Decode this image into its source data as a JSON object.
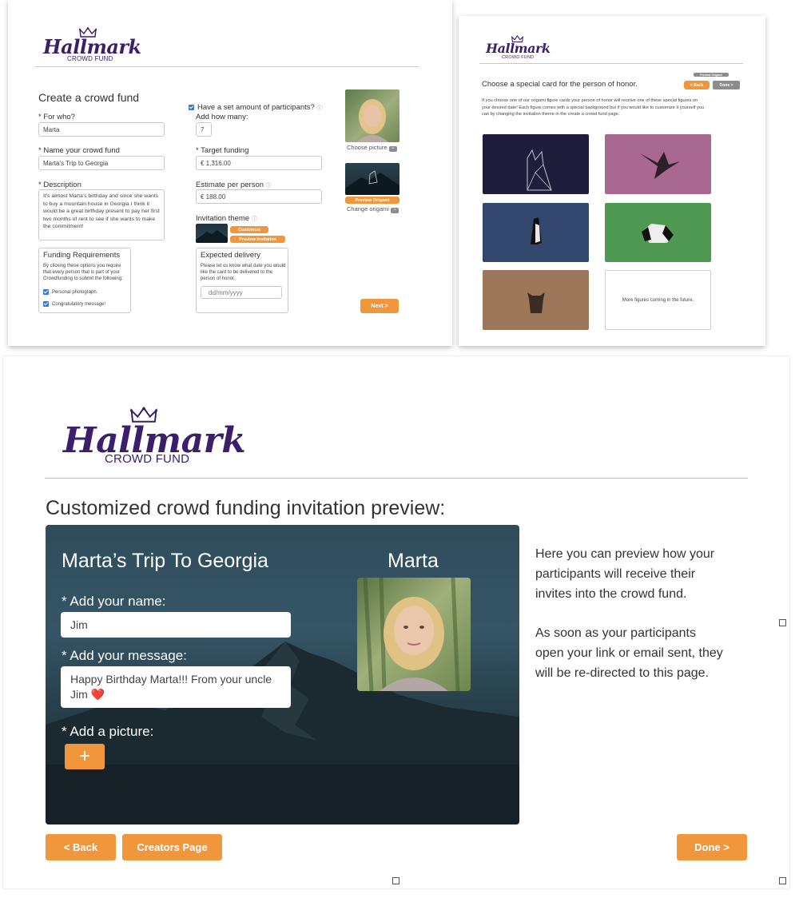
{
  "logo": {
    "script": "Hallmark",
    "sub": "CROWD FUND"
  },
  "p1": {
    "title": "Create a crowd fund",
    "for_who_label": "* For who?",
    "for_who_value": "Marta",
    "name_label": "* Name your crowd fund",
    "name_value": "Marta’s Trip to Georgia",
    "desc_label": "* Description",
    "desc_value": "It’s almost Marta’s birthday and since she wants to buy a mountain house in Georgia I think it would be a great birthday present to pay her first two months of rent to see if she wants to make the commitment!",
    "funding_title": "Funding Requirements",
    "funding_text": "By clicking these options you require that every person that is part of your Crowdfunding to submit the following:",
    "req1": "Personal photograph.",
    "req2": "Congratulatory message!",
    "participants_label": "Have a set amount of participants?",
    "info": "ⓘ",
    "add_how_many": "Add how many:",
    "participants_value": "7",
    "target_label": "* Target funding",
    "target_value": "€ 1,316.00",
    "estimate_label": "Estimate per person",
    "estimate_value": "€ 188.00",
    "theme_label": "Invitation theme",
    "customize": "Customize",
    "preview_invitation": "Preview Invitation",
    "delivery_title": "Expected delivery",
    "delivery_text": "Please let us know what date you would like the card to be delivered to the person of honor.",
    "date_placeholder": "dd/mm/yyyy",
    "choose_picture": "Choose picture",
    "preview_origami": "Preview Origami",
    "change_origami": "Change origami",
    "next": "Next >"
  },
  "p2": {
    "preview_origami": "Preview Origami",
    "title": "Choose a special card for the person of honor.",
    "back": "< Back",
    "done": "Done >",
    "text": "If you choose one of our origami figure cards your person of honor will receive one of these special figures on your desired date! Each figure comes with a special background but if you would like to customize it yourself you can by  changing the invitation theme in the create a crowd fund page.",
    "more": "More figures coming in the future.",
    "cards": [
      {
        "name": "fox",
        "color": "#1f1d3b"
      },
      {
        "name": "crane",
        "color": "#a8688f"
      },
      {
        "name": "penguin",
        "color": "#33476d"
      },
      {
        "name": "panda",
        "color": "#4e9a52"
      },
      {
        "name": "bull",
        "color": "#9c7759"
      }
    ]
  },
  "p3": {
    "heading": "Customized crowd funding invitation preview:",
    "fund_title": "Marta’s Trip To Georgia",
    "honoree": "Marta",
    "name_label": "* Add your name:",
    "name_value": "Jim",
    "message_label": "* Add your message:",
    "message_value": "Happy Birthday Marta!!! From your uncle Jim ❤️",
    "picture_label": "* Add a picture:",
    "plus": "+",
    "info1": "Here you can preview how your participants will receive their invites into the crowd fund.",
    "info2": "As soon as your participants open your link or email sent, they will be re-directed to this page.",
    "back": "< Back",
    "creators": "Creators Page",
    "done": "Done >"
  }
}
